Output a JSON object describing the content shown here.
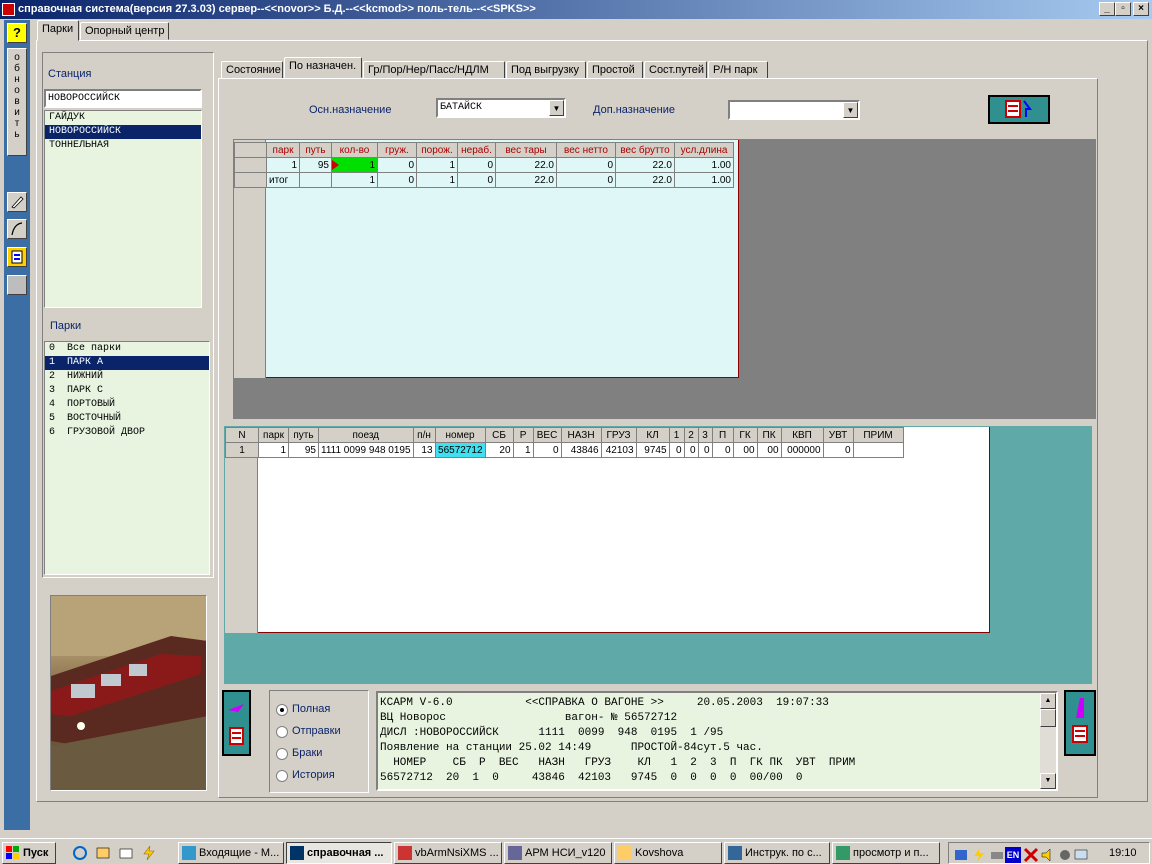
{
  "window": {
    "title": "справочная система(версия 27.3.03) сервер--<<novor>> Б.Д.--<<kcmod>> поль-тель--<<SPKS>>",
    "minimize": "_",
    "maximize": "▫",
    "close": "×"
  },
  "sidebar": {
    "help": "?",
    "refresh_label": "обновить"
  },
  "top_tabs": [
    "Парки",
    "Опорный центр"
  ],
  "left_panel": {
    "station_label": "Станция",
    "station_value": "НОВОРОССИЙСК",
    "stations": [
      "ГАЙДУК",
      "НОВОРОССИЙСК",
      "ТОННЕЛЬНАЯ"
    ],
    "selected_station": 1,
    "parks_label": "Парки",
    "parks": [
      "0  Все парки",
      "1  ПАРК А",
      "2  НИЖНИЙ",
      "3  ПАРК С",
      "4  ПОРТОВЫЙ",
      "5  ВОСТОЧНЫЙ",
      "6  ГРУЗОВОЙ ДВОР"
    ],
    "selected_park": 1
  },
  "tabs": [
    "Состояние",
    "По назначен.",
    "Гр/Пор/Нер/Пасс/НДЛМ",
    "Под выгрузку",
    "Простой",
    "Сост.путей",
    "Р/Н парк"
  ],
  "active_tab": 1,
  "filters": {
    "main_dest_label": "Осн.назначение",
    "main_dest_value": "БАТАЙСК",
    "extra_dest_label": "Доп.назначение",
    "extra_dest_value": ""
  },
  "summary_table": {
    "headers": [
      "парк",
      "путь",
      "кол-во",
      "груж.",
      "порож.",
      "нераб.",
      "вес тары",
      "вес нетто",
      "вес брутто",
      "усл.длина"
    ],
    "rows": [
      [
        "1",
        "95",
        "1",
        "0",
        "1",
        "0",
        "22.0",
        "0",
        "22.0",
        "1.00"
      ],
      [
        "итог",
        "",
        "1",
        "0",
        "1",
        "0",
        "22.0",
        "0",
        "22.0",
        "1.00"
      ]
    ]
  },
  "wagon_table": {
    "headers": [
      "N",
      "парк",
      "путь",
      "поезд",
      "п/н",
      "номер",
      "СБ",
      "Р",
      "ВЕС",
      "НАЗН",
      "ГРУЗ",
      "КЛ",
      "1",
      "2",
      "3",
      "П",
      "ГК",
      "ПК",
      "КВП",
      "УВТ",
      "ПРИМ"
    ],
    "rows": [
      [
        "1",
        "1",
        "95",
        "1111 0099 948 0195",
        "13",
        "56572712",
        "20",
        "1",
        "0",
        "43846",
        "42103",
        "9745",
        "0",
        "0",
        "0",
        "0",
        "00",
        "00",
        "000000",
        "0",
        ""
      ]
    ]
  },
  "report_mode": {
    "options": [
      "Полная",
      "Отправки",
      "Браки",
      "История"
    ],
    "selected": 0
  },
  "report_text": [
    "КСАРМ V-6.0           <<СПРАВКА О ВАГОНЕ >>     20.05.2003  19:07:33",
    "ВЦ Новорос                  вагон- № 56572712",
    "ДИСЛ :НОВОРОССИЙСК      1111  0099  948  0195  1 /95",
    "Появление на станции 25.02 14:49      ПРОСТОЙ-84сут.5 час.",
    "  НОМЕР    СБ  Р  ВЕС   НАЗН   ГРУЗ    КЛ   1  2  3  П  ГК ПК  УВТ  ПРИМ",
    "56572712  20  1  0     43846  42103   9745  0  0  0  0  00/00  0"
  ],
  "taskbar": {
    "start": "Пуск",
    "items": [
      "Входящие - M...",
      "справочная ...",
      "vbArmNsiXMS ...",
      "АРМ НСИ_v120",
      "Kovshova",
      "Инструк. по с...",
      "просмотр и п..."
    ],
    "active_item": 1,
    "lang": "EN",
    "clock": "19:10"
  },
  "colors": {
    "title_start": "#0a246a",
    "title_end": "#a6caf0",
    "side_bar": "#3a6ea5",
    "grid_light": "#dff7f7",
    "gray_panel": "#808080",
    "teal_panel": "#5fa9a9",
    "highlight_green": "#00e000",
    "highlight_cyan": "#40e0f0"
  }
}
